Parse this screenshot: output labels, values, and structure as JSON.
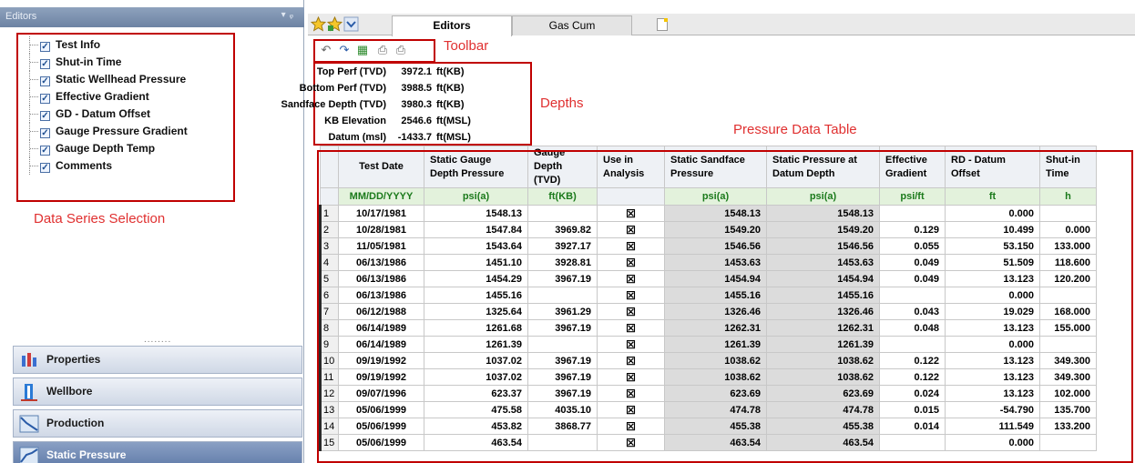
{
  "left_panel": {
    "title": "Editors",
    "series": [
      {
        "label": "Test Info",
        "checked": true
      },
      {
        "label": "Shut-in Time",
        "checked": true
      },
      {
        "label": "Static Wellhead Pressure",
        "checked": true
      },
      {
        "label": "Effective Gradient",
        "checked": true
      },
      {
        "label": "GD - Datum Offset",
        "checked": true
      },
      {
        "label": "Gauge Pressure Gradient",
        "checked": true
      },
      {
        "label": "Gauge Depth Temp",
        "checked": true
      },
      {
        "label": "Comments",
        "checked": true
      }
    ],
    "annotation": "Data Series Selection",
    "splitter": "........",
    "nav": [
      {
        "label": "Properties",
        "icon": "properties-icon",
        "active": false
      },
      {
        "label": "Wellbore",
        "icon": "wellbore-icon",
        "active": false
      },
      {
        "label": "Production",
        "icon": "production-icon",
        "active": false
      },
      {
        "label": "Static Pressure",
        "icon": "static-pressure-icon",
        "active": true
      }
    ]
  },
  "tabs": [
    {
      "label": "Editors",
      "active": true
    },
    {
      "label": "Gas Cum",
      "active": false
    }
  ],
  "toolbar": {
    "annotation": "Toolbar",
    "icons": [
      "undo-icon",
      "redo-icon",
      "excel-export-icon",
      "print-preview-icon",
      "print-icon"
    ]
  },
  "depths": {
    "annotation": "Depths",
    "rows": [
      {
        "label": "Top Perf (TVD)",
        "value": "3972.1",
        "unit": "ft(KB)"
      },
      {
        "label": "Bottom Perf (TVD)",
        "value": "3988.5",
        "unit": "ft(KB)"
      },
      {
        "label": "Sandface Depth (TVD)",
        "value": "3980.3",
        "unit": "ft(KB)"
      },
      {
        "label": "KB Elevation",
        "value": "2546.6",
        "unit": "ft(MSL)"
      },
      {
        "label": "Datum (msl)",
        "value": "-1433.7",
        "unit": "ft(MSL)"
      }
    ]
  },
  "table": {
    "annotation": "Pressure Data Table",
    "columns": [
      {
        "header": "Test Date",
        "unit": "MM/DD/YYYY"
      },
      {
        "header": "Static Gauge Depth Pressure",
        "unit": "psi(a)"
      },
      {
        "header": "Gauge Depth (TVD)",
        "unit": "ft(KB)"
      },
      {
        "header": "Use in Analysis",
        "unit": ""
      },
      {
        "header": "Static Sandface Pressure",
        "unit": "psi(a)"
      },
      {
        "header": "Static Pressure at Datum Depth",
        "unit": "psi(a)"
      },
      {
        "header": "Effective Gradient",
        "unit": "psi/ft"
      },
      {
        "header": "RD - Datum Offset",
        "unit": "ft"
      },
      {
        "header": "Shut-in Time",
        "unit": "h"
      }
    ],
    "rows": [
      [
        "1",
        "10/17/1981",
        "1548.13",
        "",
        "☒",
        "1548.13",
        "1548.13",
        "",
        "0.000",
        ""
      ],
      [
        "2",
        "10/28/1981",
        "1547.84",
        "3969.82",
        "☒",
        "1549.20",
        "1549.20",
        "0.129",
        "10.499",
        "0.000"
      ],
      [
        "3",
        "11/05/1981",
        "1543.64",
        "3927.17",
        "☒",
        "1546.56",
        "1546.56",
        "0.055",
        "53.150",
        "133.000"
      ],
      [
        "4",
        "06/13/1986",
        "1451.10",
        "3928.81",
        "☒",
        "1453.63",
        "1453.63",
        "0.049",
        "51.509",
        "118.600"
      ],
      [
        "5",
        "06/13/1986",
        "1454.29",
        "3967.19",
        "☒",
        "1454.94",
        "1454.94",
        "0.049",
        "13.123",
        "120.200"
      ],
      [
        "6",
        "06/13/1986",
        "1455.16",
        "",
        "☒",
        "1455.16",
        "1455.16",
        "",
        "0.000",
        ""
      ],
      [
        "7",
        "06/12/1988",
        "1325.64",
        "3961.29",
        "☒",
        "1326.46",
        "1326.46",
        "0.043",
        "19.029",
        "168.000"
      ],
      [
        "8",
        "06/14/1989",
        "1261.68",
        "3967.19",
        "☒",
        "1262.31",
        "1262.31",
        "0.048",
        "13.123",
        "155.000"
      ],
      [
        "9",
        "06/14/1989",
        "1261.39",
        "",
        "☒",
        "1261.39",
        "1261.39",
        "",
        "0.000",
        ""
      ],
      [
        "10",
        "09/19/1992",
        "1037.02",
        "3967.19",
        "☒",
        "1038.62",
        "1038.62",
        "0.122",
        "13.123",
        "349.300"
      ],
      [
        "11",
        "09/19/1992",
        "1037.02",
        "3967.19",
        "☒",
        "1038.62",
        "1038.62",
        "0.122",
        "13.123",
        "349.300"
      ],
      [
        "12",
        "09/07/1996",
        "623.37",
        "3967.19",
        "☒",
        "623.69",
        "623.69",
        "0.024",
        "13.123",
        "102.000"
      ],
      [
        "13",
        "05/06/1999",
        "475.58",
        "4035.10",
        "☒",
        "474.78",
        "474.78",
        "0.015",
        "-54.790",
        "135.700"
      ],
      [
        "14",
        "05/06/1999",
        "453.82",
        "3868.77",
        "☒",
        "455.38",
        "455.38",
        "0.014",
        "111.549",
        "133.200"
      ],
      [
        "15",
        "05/06/1999",
        "463.54",
        "",
        "☒",
        "463.54",
        "463.54",
        "",
        "0.000",
        ""
      ]
    ]
  },
  "colors": {
    "annotation_red": "#e03030",
    "box_red": "#c00000",
    "unit_green": "#1b7a1b",
    "computed_gray": "#dcdcdc",
    "header_blue": "#7d92b2"
  }
}
